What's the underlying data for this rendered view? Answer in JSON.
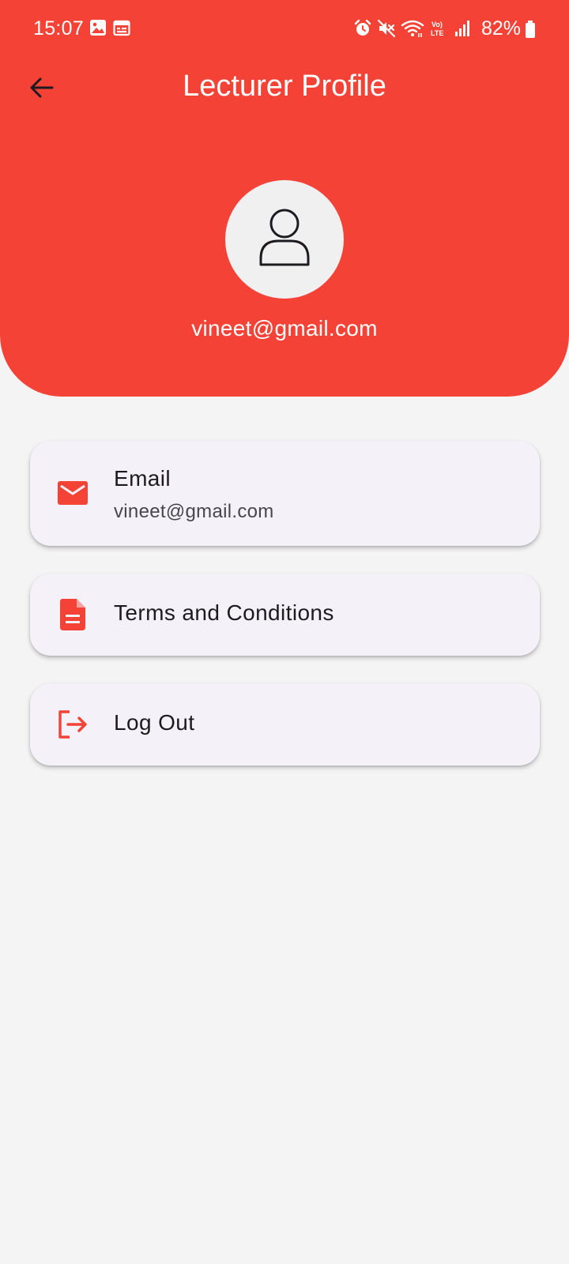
{
  "status_bar": {
    "time": "15:07",
    "battery": "82%",
    "left_icons": [
      "gallery-icon",
      "calendar-icon"
    ],
    "right_icons": [
      "alarm-icon",
      "mute-icon",
      "wifi-icon",
      "volte-icon",
      "signal-icon",
      "battery-icon"
    ]
  },
  "app_bar": {
    "title": "Lecturer Profile",
    "back_icon": "arrow-back-icon"
  },
  "profile": {
    "avatar_icon": "person-outline-icon",
    "email": "vineet@gmail.com"
  },
  "cards": [
    {
      "icon": "mail-icon",
      "title": "Email",
      "subtitle": "vineet@gmail.com"
    },
    {
      "icon": "document-icon",
      "title": "Terms and Conditions"
    },
    {
      "icon": "logout-icon",
      "title": "Log Out"
    }
  ],
  "colors": {
    "primary": "#f44336",
    "background": "#f4f4f4",
    "card_background": "#f5f1f8",
    "title_text": "#1d1b20",
    "subtitle_text": "#49454f"
  }
}
